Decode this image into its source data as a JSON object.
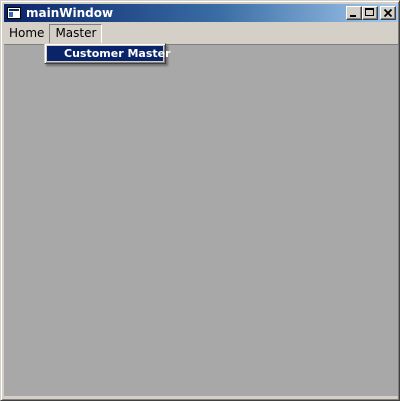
{
  "window": {
    "title": "mainWindow",
    "title_gradient_start": "#0a246a",
    "title_gradient_end": "#a6caf0"
  },
  "caption_buttons": {
    "minimize_icon": "minimize-icon",
    "maximize_icon": "maximize-icon",
    "close_icon": "close-icon"
  },
  "menubar": {
    "items": [
      {
        "label": "Home"
      },
      {
        "label": "Master",
        "open": true
      }
    ]
  },
  "dropdown": {
    "items": [
      {
        "label": "Customer Master",
        "highlighted": true
      }
    ],
    "highlight_color": "#0a246a"
  },
  "client_area": {
    "background": "#a8a8a8"
  }
}
